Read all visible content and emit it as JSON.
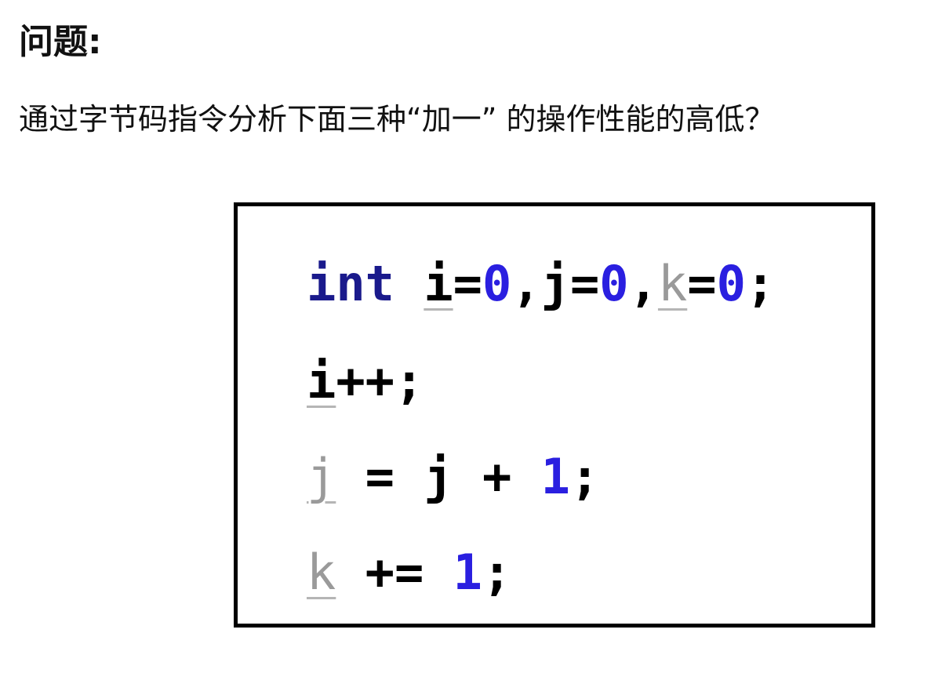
{
  "heading": "问题:",
  "question": "通过字节码指令分析下面三种“加一” 的操作性能的高低？",
  "code": {
    "line1": {
      "kw": "int",
      "v1": "i",
      "eq1": "=",
      "n1": "0",
      "c1": ",",
      "v2": "j",
      "eq2": "=",
      "n2": "0",
      "c2": ",",
      "v3": "k",
      "eq3": "=",
      "n3": "0",
      "semi": ";"
    },
    "line2": {
      "v": "i",
      "op": "++",
      "semi": ";"
    },
    "line3": {
      "v": "j",
      "eq": "=",
      "v2": "j",
      "plus": "+",
      "n": "1",
      "semi": ";"
    },
    "line4": {
      "v": "k",
      "op": "+=",
      "n": "1",
      "semi": ";"
    }
  }
}
